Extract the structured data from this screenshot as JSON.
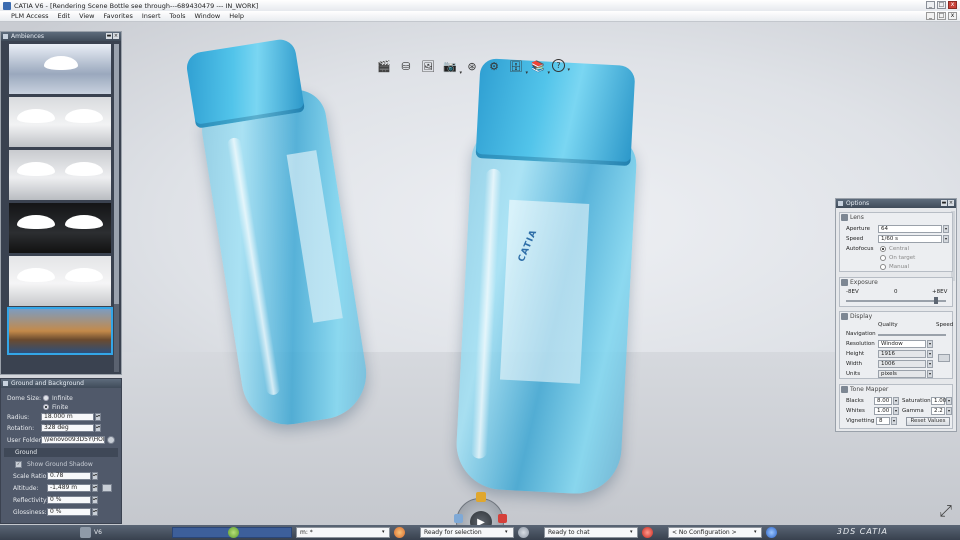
{
  "window": {
    "title": "CATIA V6 - [Rendering Scene Bottle see through---689430479 --- IN_WORK]",
    "minimize": "_",
    "restore": "□",
    "close": "x"
  },
  "menu": {
    "items": [
      "PLM Access",
      "Edit",
      "View",
      "Favorites",
      "Insert",
      "Tools",
      "Window",
      "Help"
    ]
  },
  "view_toolbar": {
    "icons": [
      {
        "name": "clapper-icon",
        "glyph": "🎬"
      },
      {
        "name": "disc-icon",
        "glyph": "⛁"
      },
      {
        "name": "picture-icon",
        "glyph": "🖼"
      },
      {
        "name": "camera-icon",
        "glyph": "📷"
      },
      {
        "name": "render-icon",
        "glyph": "⊛"
      },
      {
        "name": "settings-icon",
        "glyph": "⚙"
      },
      {
        "name": "database-icon",
        "glyph": "🗄"
      },
      {
        "name": "catalog-icon",
        "glyph": "📚"
      },
      {
        "name": "help-icon",
        "glyph": "?"
      }
    ]
  },
  "ambiences": {
    "title": "Ambiences"
  },
  "ground_panel": {
    "title": "Ground and Background",
    "dome_size_label": "Dome Size:",
    "dome_options": [
      "Infinite",
      "Finite"
    ],
    "radius_label": "Radius:",
    "radius_value": "18.000 m",
    "rotation_label": "Rotation:",
    "rotation_value": "328 deg",
    "user_folder_label": "User Folder:",
    "user_folder_value": "\\\\lenovo093D5Y\\HOMEVC",
    "ground_header": "Ground",
    "show_ground_label": "Show Ground Shadow",
    "scale_ratio_label": "Scale Ratio:",
    "scale_ratio_value": "0.78",
    "altitude_label": "Altitude:",
    "altitude_value": "-1,489 m",
    "reflectivity_label": "Reflectivity:",
    "reflectivity_value": "0 %",
    "glossiness_label": "Glossiness:",
    "glossiness_value": "0 %"
  },
  "options_panel": {
    "title": "Options",
    "lens_header": "Lens",
    "aperture_label": "Aperture",
    "aperture_value": "64",
    "speed_label": "Speed",
    "speed_value": "1/60 s",
    "autofocus_label": "Autofocus",
    "autofocus_options": [
      "Central",
      "On target",
      "Manual"
    ],
    "exposure_header": "Exposure",
    "exposure_min": "-8EV",
    "exposure_mid": "0",
    "exposure_max": "+8EV",
    "display_header": "Display",
    "quality_label": "Quality",
    "speed_col_label": "Speed",
    "navigation_label": "Navigation",
    "resolution_label": "Resolution",
    "resolution_value": "Window",
    "height_label": "Height",
    "height_value": "1916",
    "width_label": "Width",
    "width_value": "1006",
    "units_label": "Units",
    "units_value": "pixels",
    "tone_header": "Tone Mapper",
    "blacks_label": "Blacks",
    "blacks_value": "8.00",
    "saturation_label": "Saturation",
    "saturation_value": "1.00",
    "whites_label": "Whites",
    "whites_value": "1.00",
    "gamma_label": "Gamma",
    "gamma_value": "2.2",
    "vignetting_label": "Vignetting",
    "vignetting_value": "8",
    "reset_label": "Reset Values"
  },
  "scene": {
    "bottle_brand": "CATIA"
  },
  "statusbar": {
    "workbench": "V6",
    "command_field": "m: *",
    "selection_status": "Ready for selection",
    "chat_status": "Ready to chat",
    "configuration": "< No Configuration >",
    "logo": "3DS CATIA"
  }
}
